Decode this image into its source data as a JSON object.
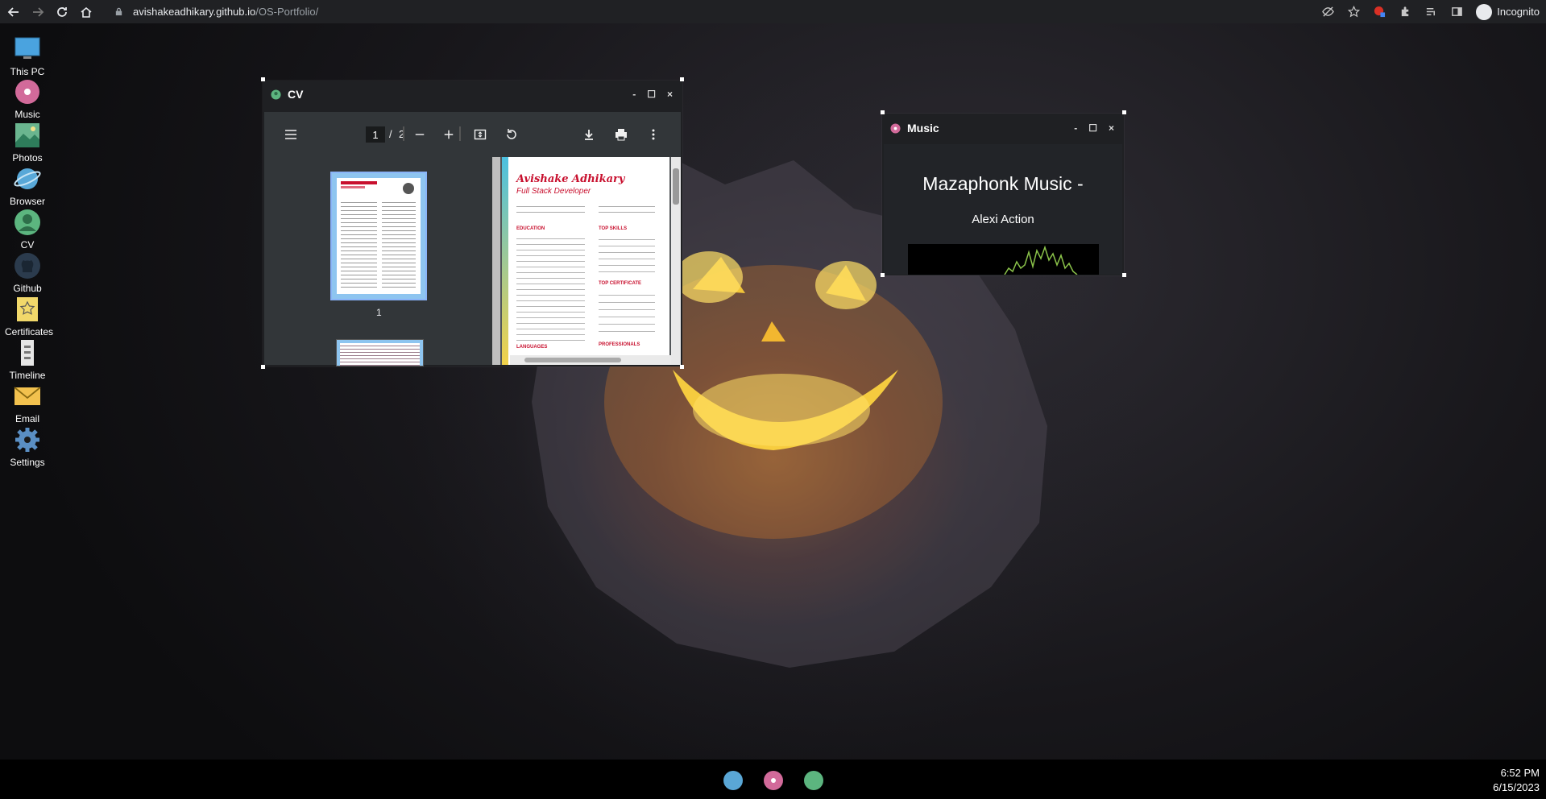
{
  "browser": {
    "url_host": "avishakeadhikary.github.io",
    "url_path": "/OS-Portfolio/",
    "profile_label": "Incognito"
  },
  "desktop_icons": [
    {
      "label": "This PC",
      "icon": "monitor-icon"
    },
    {
      "label": "Music",
      "icon": "music-disc-icon"
    },
    {
      "label": "Photos",
      "icon": "photos-icon"
    },
    {
      "label": "Browser",
      "icon": "planet-icon"
    },
    {
      "label": "CV",
      "icon": "user-icon"
    },
    {
      "label": "Github",
      "icon": "github-icon"
    },
    {
      "label": "Certificates",
      "icon": "star-certificate-icon"
    },
    {
      "label": "Timeline",
      "icon": "timeline-icon"
    },
    {
      "label": "Email",
      "icon": "envelope-icon"
    },
    {
      "label": "Settings",
      "icon": "gear-icon"
    }
  ],
  "cv_window": {
    "title": "CV",
    "controls": {
      "minimize": "-",
      "maximize": "☐",
      "close": "×"
    },
    "pdf": {
      "current_page": "1",
      "separator": "/",
      "total_pages": "2",
      "thumbnail_label": "1",
      "doc": {
        "name": "Avishake Adhikary",
        "role": "Full Stack Developer",
        "sections_left": [
          "EDUCATION",
          "LANGUAGES"
        ],
        "sections_right": [
          "TOP SKILLS",
          "TOP CERTIFICATE",
          "PROFESSIONALS"
        ]
      }
    }
  },
  "music_window": {
    "title": "Music",
    "controls": {
      "minimize": "-",
      "maximize": "☐",
      "close": "×"
    },
    "song_title": "Mazaphonk Music -",
    "artist": "Alexi Action"
  },
  "taskbar": {
    "apps": [
      "browser-icon",
      "music-icon",
      "cv-icon"
    ],
    "time": "6:52 PM",
    "date": "6/15/2023"
  },
  "colors": {
    "chrome_bg": "#202124",
    "window_bg": "#1f2023",
    "pdf_toolbar": "#323639",
    "accent_red": "#c8102e"
  }
}
